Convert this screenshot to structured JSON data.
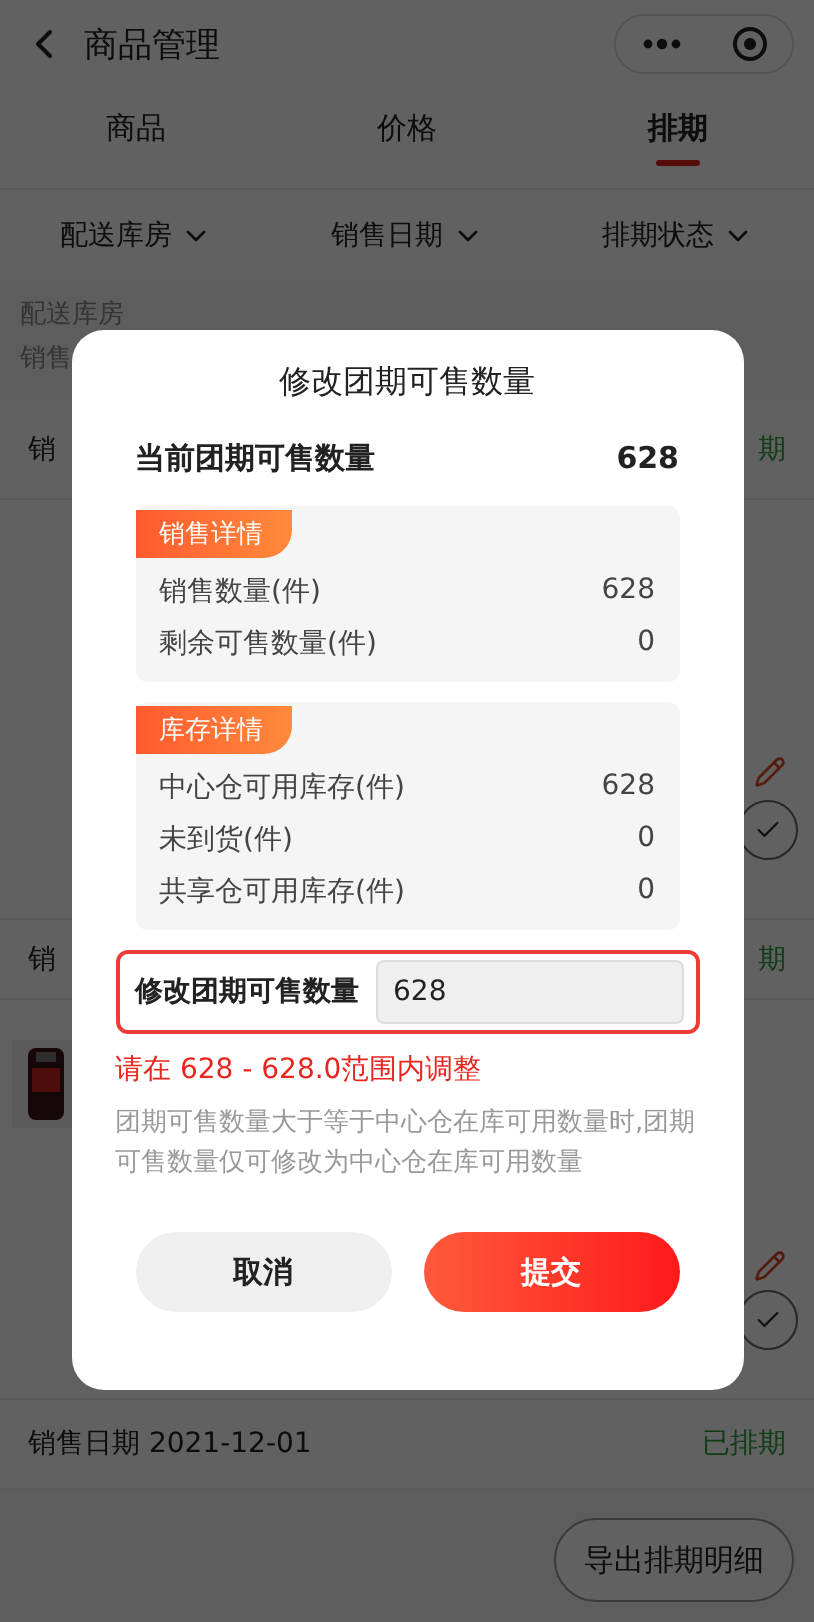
{
  "header": {
    "title": "商品管理"
  },
  "tabs": [
    {
      "label": "商品",
      "selected": false
    },
    {
      "label": "价格",
      "selected": false
    },
    {
      "label": "排期",
      "selected": true
    }
  ],
  "filters": [
    {
      "label": "配送库房"
    },
    {
      "label": "销售日期"
    },
    {
      "label": "排期状态"
    }
  ],
  "info": {
    "lines": [
      "配送库房",
      "销售"
    ]
  },
  "list": [
    {
      "kind": "date",
      "label": "销",
      "status": "期"
    },
    {
      "kind": "card",
      "picture": false
    },
    {
      "kind": "date",
      "label": "销",
      "status": "期"
    },
    {
      "kind": "card",
      "picture": true
    },
    {
      "kind": "date",
      "label": "销售日期 2021-12-01",
      "status": "已排期"
    }
  ],
  "export_button": "导出排期明细",
  "dialog": {
    "title": "修改团期可售数量",
    "current": {
      "label": "当前团期可售数量",
      "value": "628"
    },
    "sections": [
      {
        "tag": "销售详情",
        "rows": [
          {
            "label": "销售数量(件)",
            "value": "628"
          },
          {
            "label": "剩余可售数量(件)",
            "value": "0"
          }
        ]
      },
      {
        "tag": "库存详情",
        "rows": [
          {
            "label": "中心仓可用库存(件)",
            "value": "628"
          },
          {
            "label": "未到货(件)",
            "value": "0"
          },
          {
            "label": "共享仓可用库存(件)",
            "value": "0"
          }
        ]
      }
    ],
    "input": {
      "label": "修改团期可售数量",
      "value": "628"
    },
    "range_hint": "请在 628 - 628.0范围内调整",
    "note": "团期可售数量大于等于中心仓在库可用数量时,团期可售数量仅可修改为中心仓在库可用数量",
    "buttons": [
      {
        "label": "取消",
        "kind": "secondary"
      },
      {
        "label": "提交",
        "kind": "primary"
      }
    ]
  }
}
